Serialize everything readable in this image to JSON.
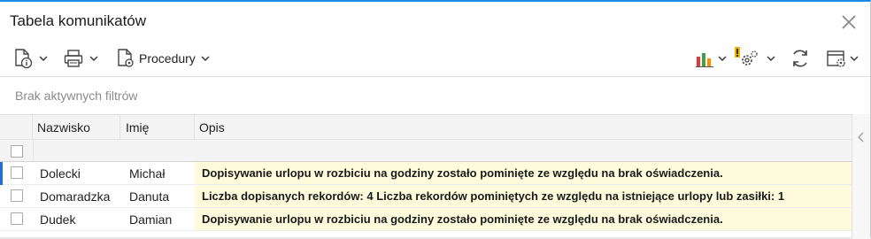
{
  "window": {
    "title": "Tabela komunikatów"
  },
  "toolbar": {
    "procedures_label": "Procedury"
  },
  "filter": {
    "status_text": "Brak aktywnych filtrów"
  },
  "table": {
    "columns": [
      "Nazwisko",
      "Imię",
      "Opis"
    ],
    "rows": [
      {
        "surname": "Dolecki",
        "name": "Michał",
        "description": "Dopisywanie urlopu w rozbiciu na godziny zostało pominięte ze względu na brak oświadczenia.",
        "selected": true
      },
      {
        "surname": "Domaradzka",
        "name": "Danuta",
        "description": "Liczba dopisanych rekordów: 4  Liczba rekordów pominiętych ze względu na istniejące urlopy lub zasiłki: 1",
        "selected": false
      },
      {
        "surname": "Dudek",
        "name": "Damian",
        "description": "Dopisywanie urlopu w rozbiciu na godziny zostało pominięte ze względu na brak oświadczenia.",
        "selected": false
      }
    ]
  },
  "colors": {
    "accent": "#1e88e5",
    "description_highlight": "#fdfbdc",
    "selection_marker": "#1e6fd0"
  },
  "icons": [
    "document-info-icon",
    "print-icon",
    "procedure-icon",
    "chart-icon",
    "settings-alert-icon",
    "refresh-icon",
    "window-settings-icon",
    "close-icon",
    "collapse-panel-icon"
  ]
}
